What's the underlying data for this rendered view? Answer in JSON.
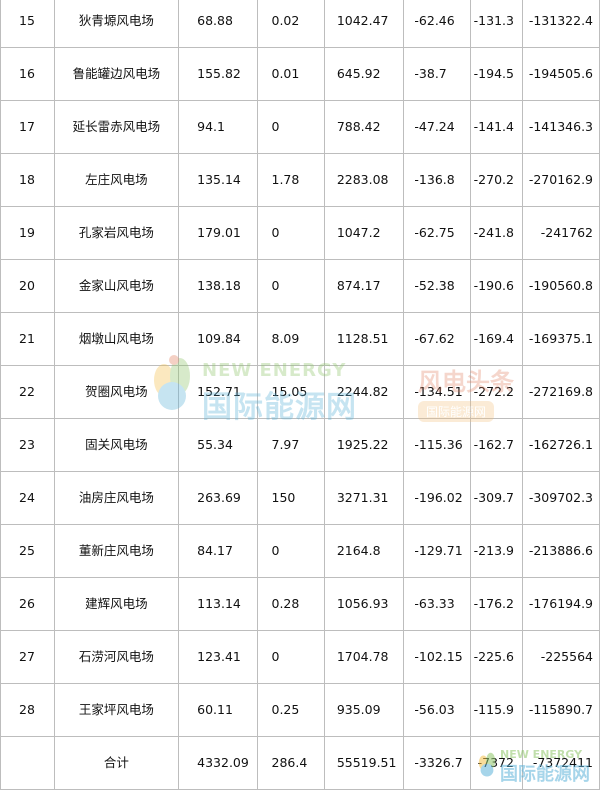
{
  "rows": [
    [
      "15",
      "狄青塬风电场",
      "68.88",
      "0.02",
      "1042.47",
      "-62.46",
      "-131.3",
      "-131322.4"
    ],
    [
      "16",
      "鲁能罐边风电场",
      "155.82",
      "0.01",
      "645.92",
      "-38.7",
      "-194.5",
      "-194505.6"
    ],
    [
      "17",
      "延长雷赤风电场",
      "94.1",
      "0",
      "788.42",
      "-47.24",
      "-141.4",
      "-141346.3"
    ],
    [
      "18",
      "左庄风电场",
      "135.14",
      "1.78",
      "2283.08",
      "-136.8",
      "-270.2",
      "-270162.9"
    ],
    [
      "19",
      "孔家岩风电场",
      "179.01",
      "0",
      "1047.2",
      "-62.75",
      "-241.8",
      "-241762"
    ],
    [
      "20",
      "金家山风电场",
      "138.18",
      "0",
      "874.17",
      "-52.38",
      "-190.6",
      "-190560.8"
    ],
    [
      "21",
      "烟墩山风电场",
      "109.84",
      "8.09",
      "1128.51",
      "-67.62",
      "-169.4",
      "-169375.1"
    ],
    [
      "22",
      "贺圈风电场",
      "152.71",
      "15.05",
      "2244.82",
      "-134.51",
      "-272.2",
      "-272169.8"
    ],
    [
      "23",
      "固关风电场",
      "55.34",
      "7.97",
      "1925.22",
      "-115.36",
      "-162.7",
      "-162726.1"
    ],
    [
      "24",
      "油房庄风电场",
      "263.69",
      "150",
      "3271.31",
      "-196.02",
      "-309.7",
      "-309702.3"
    ],
    [
      "25",
      "董新庄风电场",
      "84.17",
      "0",
      "2164.8",
      "-129.71",
      "-213.9",
      "-213886.6"
    ],
    [
      "26",
      "建辉风电场",
      "113.14",
      "0.28",
      "1056.93",
      "-63.33",
      "-176.2",
      "-176194.9"
    ],
    [
      "27",
      "石涝河风电场",
      "123.41",
      "0",
      "1704.78",
      "-102.15",
      "-225.6",
      "-225564"
    ],
    [
      "28",
      "王家坪风电场",
      "60.11",
      "0.25",
      "935.09",
      "-56.03",
      "-115.9",
      "-115890.7"
    ]
  ],
  "total": [
    "",
    "合计",
    "4332.09",
    "286.4",
    "55519.51",
    "-3326.7",
    "-7372",
    "-7372411"
  ],
  "watermarks": {
    "main_en": "NEW ENERGY",
    "main_cn": "国际能源网",
    "side_title": "风电头条",
    "side_sub": "国际能源网",
    "corner_en": "NEW ENERGY",
    "corner_cn": "国际能源网"
  },
  "colors": {
    "border": "#bdbdbd",
    "watermark_green": "#8fc66a",
    "watermark_blue": "#5fb3d9"
  }
}
